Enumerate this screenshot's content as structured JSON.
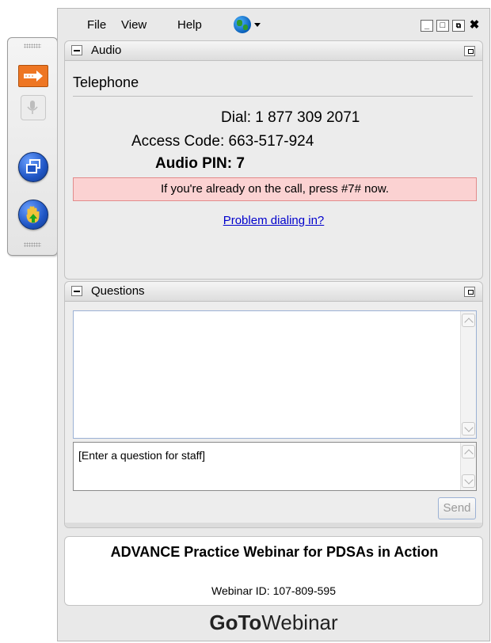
{
  "menu": {
    "file": "File",
    "view": "View",
    "help": "Help"
  },
  "audio": {
    "title": "Audio",
    "mode": "Telephone",
    "dial_label": "Dial:",
    "dial_number": "1 877 309 2071",
    "access_label": "Access Code:",
    "access_code": "663-517-924",
    "pin_label": "Audio PIN:",
    "pin_value": "7",
    "notice": "If you're already on the call, press #7# now.",
    "problem_link": "Problem dialing in?"
  },
  "questions": {
    "title": "Questions",
    "input_placeholder": "[Enter a question for staff]",
    "send_label": "Send"
  },
  "webinar": {
    "title": "ADVANCE Practice Webinar for PDSAs in Action",
    "id_label": "Webinar ID:",
    "id_value": "107-809-595"
  },
  "brand": {
    "bold": "GoTo",
    "light": "Webinar"
  },
  "colors": {
    "accent_orange": "#ee7623",
    "notice_bg": "#fbd2d2",
    "link": "#0000cc"
  },
  "icons": [
    "arrow-icon",
    "microphone-icon",
    "restore-window-icon",
    "raise-hand-icon",
    "globe-icon",
    "minimize-icon",
    "maximize-icon",
    "popout-icon",
    "close-icon"
  ]
}
